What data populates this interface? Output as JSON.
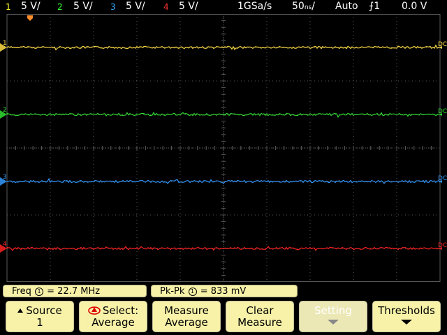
{
  "status_bar": {
    "channels": [
      {
        "num": "1",
        "scale": "5 V/",
        "color": "#ffff33"
      },
      {
        "num": "2",
        "scale": "5 V/",
        "color": "#33ff33"
      },
      {
        "num": "3",
        "scale": "5 V/",
        "color": "#33aaff"
      },
      {
        "num": "4",
        "scale": "5 V/",
        "color": "#ff3333"
      }
    ],
    "sample_rate": "1GSa/s",
    "timebase": "50",
    "timebase_unit": "ns",
    "trigger_mode": "Auto",
    "trigger_source": "1",
    "trigger_level": "0.0 V"
  },
  "traces": [
    {
      "label": "1",
      "coupling": "DC",
      "color": "#ffdd44",
      "level": 0.125
    },
    {
      "label": "2",
      "coupling": "DC",
      "color": "#33dd33",
      "level": 0.375
    },
    {
      "label": "3",
      "coupling": "DC",
      "color": "#3399ff",
      "level": 0.625
    },
    {
      "label": "4",
      "coupling": "DC",
      "color": "#ff2222",
      "level": 0.875
    }
  ],
  "measurements": {
    "freq": {
      "name": "Freq",
      "src": "1",
      "value": "22.7 MHz"
    },
    "pkpk": {
      "name": "Pk-Pk",
      "src": "1",
      "value": "833 mV"
    }
  },
  "softkeys": [
    {
      "line1": "Source",
      "line2": "1"
    },
    {
      "line1": "Select:",
      "line2": "Average"
    },
    {
      "line1": "Measure",
      "line2": "Average"
    },
    {
      "line1": "Clear",
      "line2": "Measure"
    },
    {
      "line1": "Setting"
    },
    {
      "line1": "Thresholds"
    }
  ],
  "colors": {
    "softkey_bg": "#f7f2a8",
    "grid": "#5a5a5a"
  }
}
